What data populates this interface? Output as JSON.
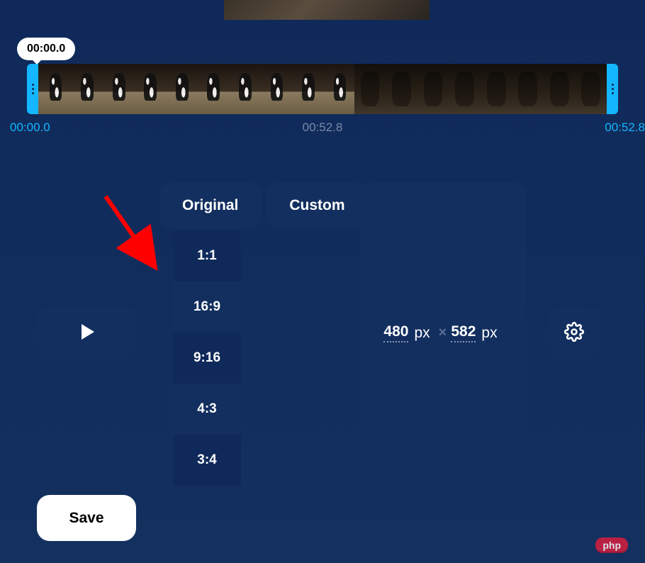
{
  "timeline": {
    "tooltip": "00:00.0",
    "start_label": "00:00.0",
    "mid_label": "00:52.8",
    "end_label": "00:52.8"
  },
  "tabs": {
    "original": "Original",
    "custom": "Custom"
  },
  "ratios": [
    "1:1",
    "16:9",
    "9:16",
    "4:3",
    "3:4"
  ],
  "dimensions": {
    "width": "480",
    "height": "582",
    "unit": "px",
    "sep": "×"
  },
  "buttons": {
    "save": "Save"
  },
  "watermark": {
    "brand": "php",
    "suffix": ""
  }
}
